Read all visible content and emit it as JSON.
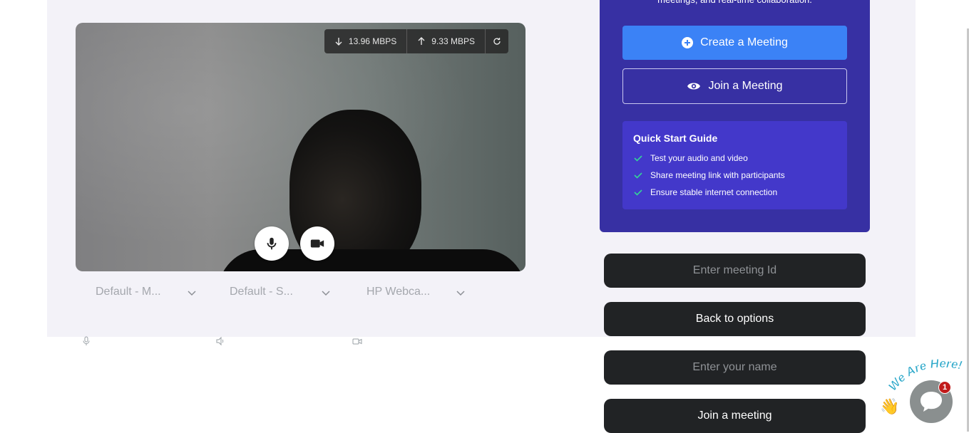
{
  "network": {
    "download": "13.96 MBPS",
    "upload": "9.33 MBPS"
  },
  "devices": {
    "microphone": "Default - M...",
    "speaker": "Default - S...",
    "camera": "HP Webca..."
  },
  "panel": {
    "tagline": "meetings, and real-time collaboration.",
    "create_label": "Create a Meeting",
    "join_label": "Join a Meeting",
    "guide_title": "Quick Start Guide",
    "guide_items": [
      "Test your audio and video",
      "Share meeting link with participants",
      "Ensure stable internet connection"
    ]
  },
  "form": {
    "meeting_id_placeholder": "Enter meeting Id",
    "back_label": "Back to options",
    "name_placeholder": "Enter your name",
    "join_label": "Join a meeting"
  },
  "chat": {
    "badge_count": "1",
    "banner": "We Are Here!"
  },
  "colors": {
    "panel": "#3730a3",
    "primary": "#3b82f6",
    "dark_button": "#212325"
  }
}
